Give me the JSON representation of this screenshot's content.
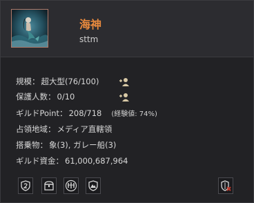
{
  "guild": {
    "name": "海神",
    "master": "sttm"
  },
  "info": {
    "scale_label": "規模：",
    "scale_value": "超大型(76/100)",
    "protected_label": "保護人数：",
    "protected_value": "0/10",
    "points_label": "ギルドPoint：",
    "points_value": "208/718",
    "points_exp": "(経験値: 74%)",
    "territory_label": "占領地域：",
    "territory_value": "メディア直轄領",
    "mounts_label": "搭乗物：",
    "mounts_value": "象(3), ガレー船(3)",
    "funds_label": "ギルド資金：",
    "funds_value": "61,000,687,964"
  },
  "colors": {
    "guild_name": "#e98a3e",
    "panel_bg": "#222225",
    "header_bg": "#2c2c30"
  },
  "icons": {
    "emblem": "mermaid-emblem",
    "add_member_1": "add-member-icon",
    "add_member_2": "add-member-icon",
    "buttons": [
      "shield-number-icon",
      "chest-icon",
      "guild-crest-icon",
      "castle-shield-icon",
      "leave-guild-icon"
    ]
  }
}
